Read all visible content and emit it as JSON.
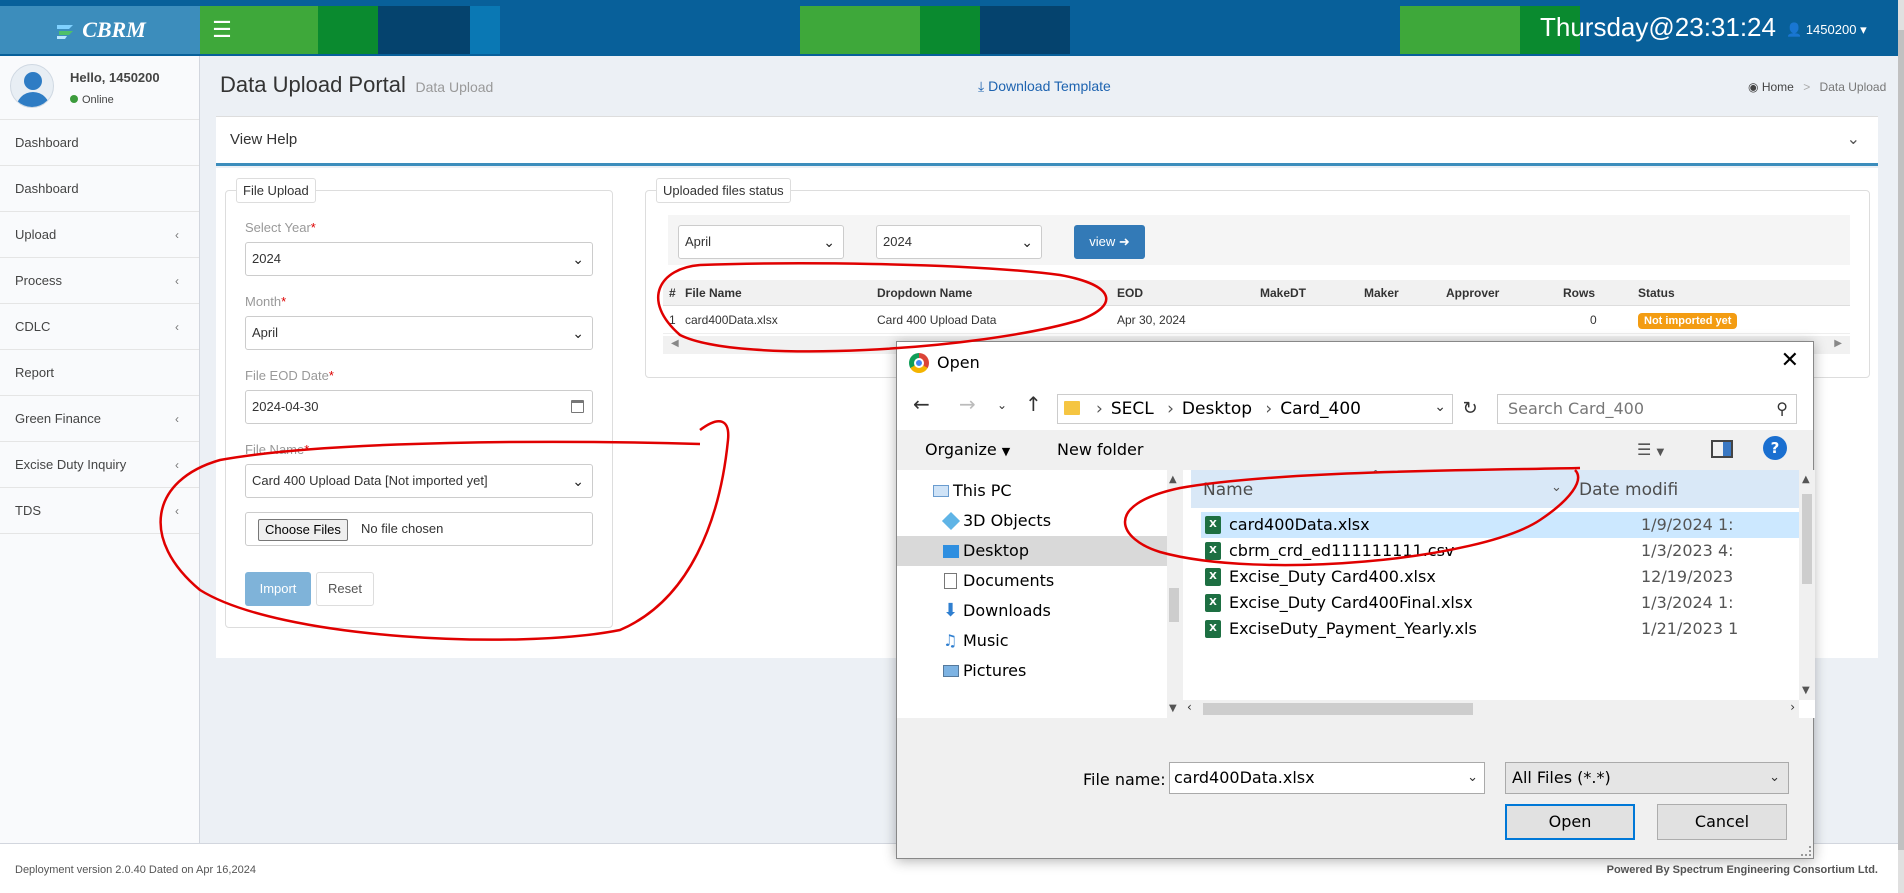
{
  "header": {
    "brand": "CBRM",
    "clock": "Thursday@23:31:24",
    "user": "1450200"
  },
  "sidebar": {
    "user_greeting": "Hello, 1450200",
    "user_status": "Online",
    "items": [
      {
        "label": "Dashboard",
        "has_submenu": false
      },
      {
        "label": "Dashboard",
        "has_submenu": false
      },
      {
        "label": "Upload",
        "has_submenu": true
      },
      {
        "label": "Process",
        "has_submenu": true
      },
      {
        "label": "CDLC",
        "has_submenu": true
      },
      {
        "label": "Report",
        "has_submenu": false
      },
      {
        "label": "Green Finance",
        "has_submenu": true
      },
      {
        "label": "Excise Duty Inquiry",
        "has_submenu": true
      },
      {
        "label": "TDS",
        "has_submenu": true
      }
    ]
  },
  "content": {
    "title": "Data Upload Portal",
    "subtitle": "Data Upload",
    "download_template": "Download Template",
    "breadcrumb": {
      "home": "Home",
      "current": "Data Upload"
    },
    "help_title": "View Help"
  },
  "upload_form": {
    "legend": "File Upload",
    "year_label": "Select Year",
    "year_value": "2024",
    "month_label": "Month",
    "month_value": "April",
    "eod_label": "File EOD Date",
    "eod_value": "2024-04-30",
    "file_name_label": "File Name",
    "file_name_value": "Card 400 Upload Data [Not imported yet]",
    "choose_files": "Choose Files",
    "no_file": "No file chosen",
    "import": "Import",
    "reset": "Reset",
    "required_mark": "*"
  },
  "status_panel": {
    "legend": "Uploaded files status",
    "month_value": "April",
    "year_value": "2024",
    "view_button": "view",
    "columns": [
      "#",
      "File Name",
      "Dropdown Name",
      "EOD",
      "MakeDT",
      "Maker",
      "Approver",
      "Rows",
      "Status"
    ],
    "rows": [
      {
        "num": "1",
        "file_name": "card400Data.xlsx",
        "dropdown_name": "Card 400 Upload Data",
        "eod": "Apr 30, 2024",
        "make_dt": "",
        "maker": "",
        "approver": "",
        "rows": "0",
        "status": "Not imported yet"
      }
    ]
  },
  "footer": {
    "left": "Deployment version 2.0.40 Dated on Apr 16,2024",
    "right": "Powered By Spectrum Engineering Consortium Ltd."
  },
  "dialog": {
    "title": "Open",
    "path": [
      "SECL",
      "Desktop",
      "Card_400"
    ],
    "search_placeholder": "Search Card_400",
    "organize": "Organize",
    "new_folder": "New folder",
    "help": "?",
    "tree": [
      {
        "label": "This PC",
        "icon": "pc-icon"
      },
      {
        "label": "3D Objects",
        "icon": "cube-icon"
      },
      {
        "label": "Desktop",
        "icon": "desktop-icon",
        "selected": true
      },
      {
        "label": "Documents",
        "icon": "documents-icon"
      },
      {
        "label": "Downloads",
        "icon": "downloads-icon"
      },
      {
        "label": "Music",
        "icon": "music-icon"
      },
      {
        "label": "Pictures",
        "icon": "pictures-icon"
      }
    ],
    "column_name": "Name",
    "column_date": "Date modifi",
    "files": [
      {
        "name": "card400Data.xlsx",
        "date": "1/9/2024 1:",
        "selected": true
      },
      {
        "name": "cbrm_crd_ed111111111.csv",
        "date": "1/3/2023 4:"
      },
      {
        "name": "Excise_Duty Card400.xlsx",
        "date": "12/19/2023"
      },
      {
        "name": "Excise_Duty Card400Final.xlsx",
        "date": "1/3/2024 1:"
      },
      {
        "name": "ExciseDuty_Payment_Yearly.xls",
        "date": "1/21/2023 1"
      }
    ],
    "file_name_label": "File name:",
    "file_name_value": "card400Data.xlsx",
    "file_type": "All Files (*.*)",
    "open_button": "Open",
    "cancel_button": "Cancel"
  },
  "colors": {
    "header_blue": "#08609a",
    "brand_blue": "#3c8dbc",
    "accent_green": "#3ea83a",
    "badge_orange": "#f39c12",
    "annotation_red": "#e00000"
  }
}
